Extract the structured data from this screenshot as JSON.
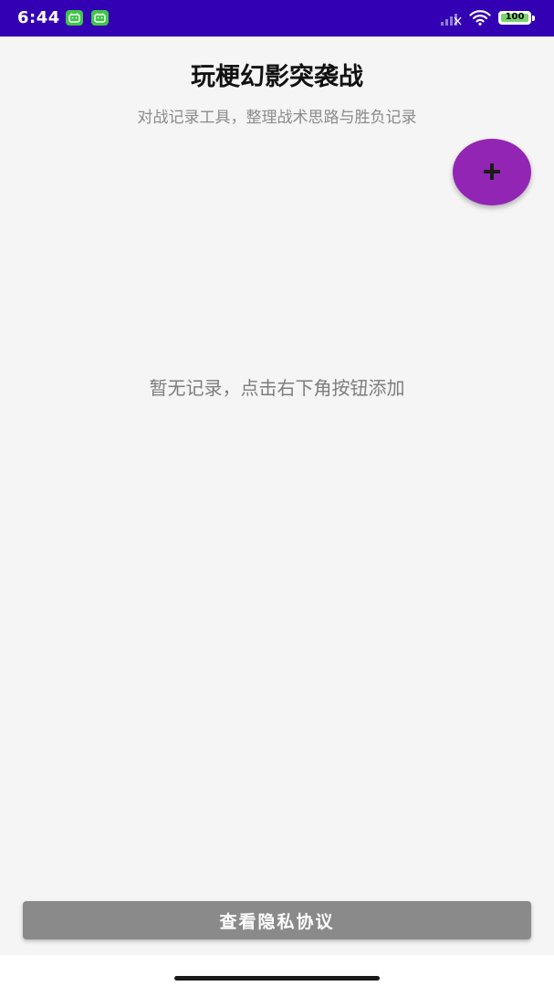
{
  "status_bar": {
    "time": "6:44",
    "battery_level": "100",
    "background_color": "#3300b3",
    "icons": [
      "app-notification-icon",
      "app-notification-icon",
      "signal-icon",
      "wifi-icon",
      "battery-icon"
    ]
  },
  "header": {
    "title": "玩梗幻影突袭战",
    "subtitle": "对战记录工具，整理战术思路与胜负记录"
  },
  "fab": {
    "icon": "plus-icon",
    "color": "#9225b4"
  },
  "main": {
    "empty_message": "暂无记录，点击右下角按钮添加"
  },
  "footer": {
    "privacy_button_label": "查看隐私协议",
    "button_color": "#8a8a8a"
  }
}
